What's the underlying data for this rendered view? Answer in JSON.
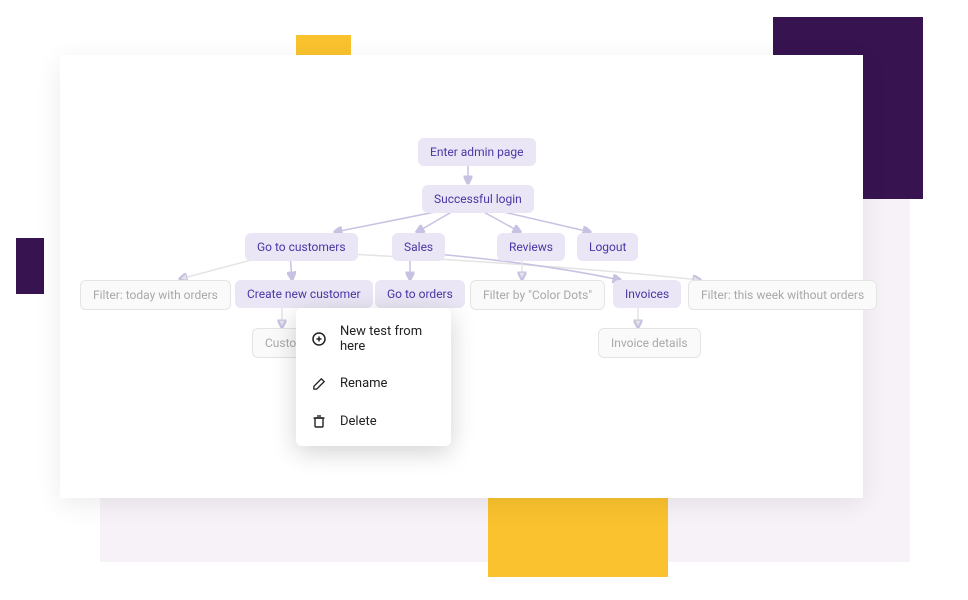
{
  "nodes": {
    "enter_admin": "Enter admin page",
    "login": "Successful login",
    "customers": "Go to customers",
    "sales": "Sales",
    "reviews": "Reviews",
    "logout": "Logout",
    "filter_today": "Filter: today with orders",
    "create_cust": "Create new customer",
    "go_orders": "Go to orders",
    "filter_color": "Filter by \"Color Dots\"",
    "invoices": "Invoices",
    "filter_week": "Filter: this week without orders",
    "custom": "Custom",
    "invoice_details": "Invoice details"
  },
  "menu": {
    "new_test": "New test from here",
    "rename": "Rename",
    "delete": "Delete"
  }
}
